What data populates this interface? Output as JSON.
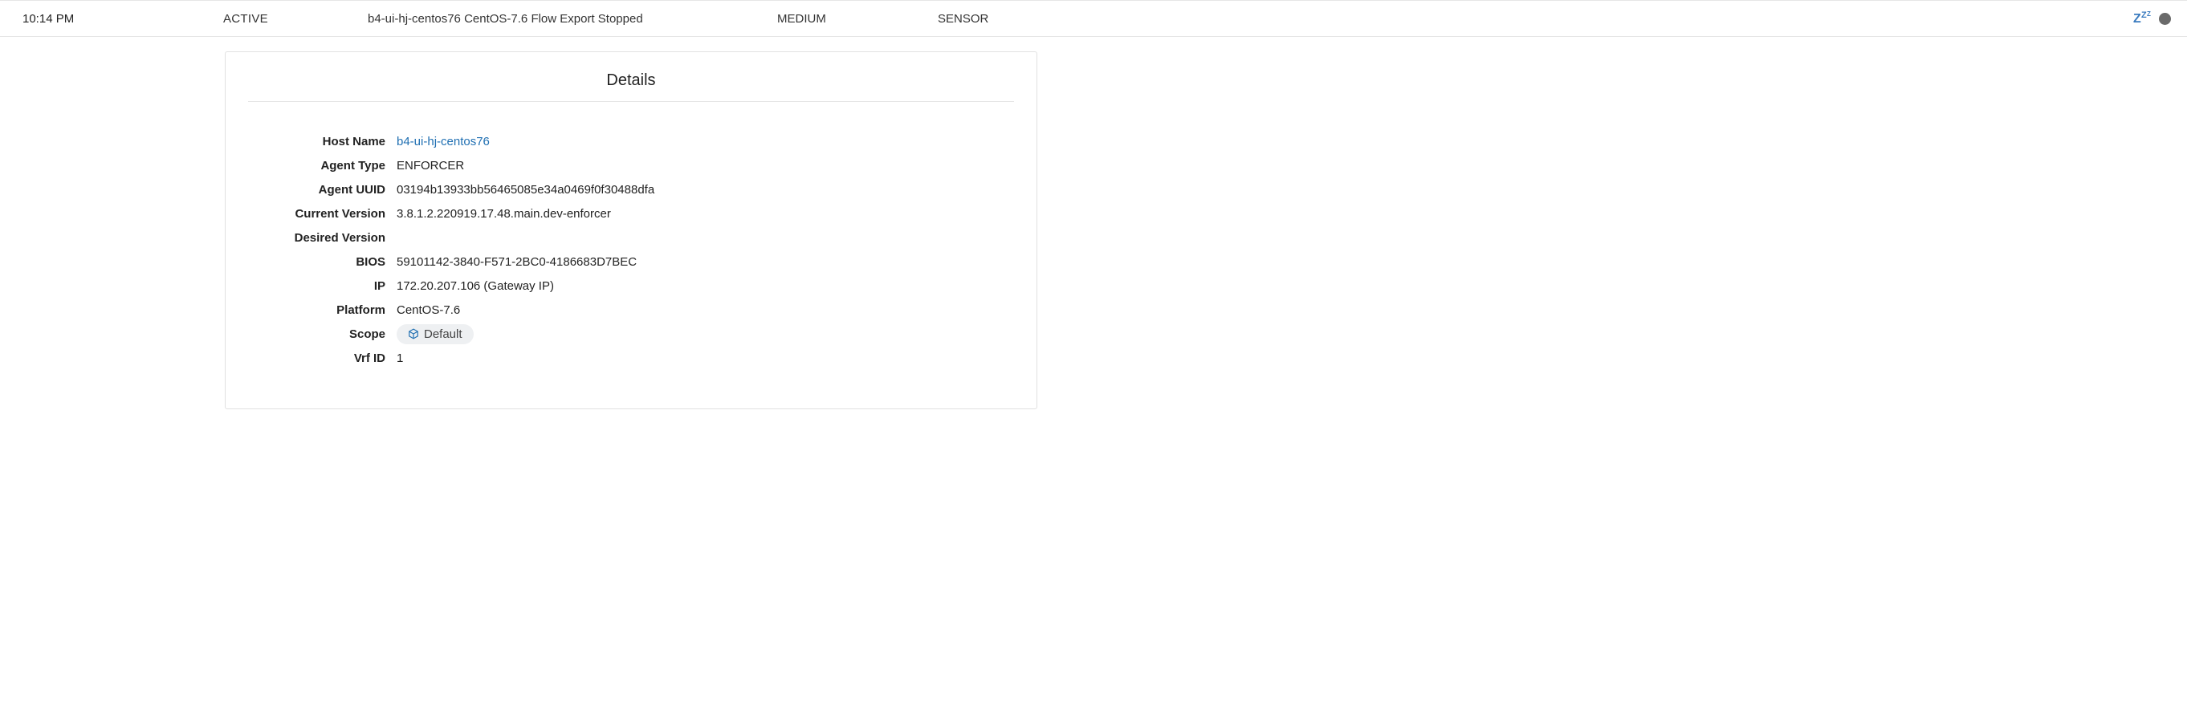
{
  "row": {
    "time": "10:14 PM",
    "status": "ACTIVE",
    "description": "b4-ui-hj-centos76 CentOS-7.6 Flow Export Stopped",
    "severity": "MEDIUM",
    "type": "SENSOR"
  },
  "details": {
    "title": "Details",
    "fields": {
      "host_name": {
        "label": "Host Name",
        "value": "b4-ui-hj-centos76"
      },
      "agent_type": {
        "label": "Agent Type",
        "value": "ENFORCER"
      },
      "agent_uuid": {
        "label": "Agent UUID",
        "value": "03194b13933bb56465085e34a0469f0f30488dfa"
      },
      "current_version": {
        "label": "Current Version",
        "value": "3.8.1.2.220919.17.48.main.dev-enforcer"
      },
      "desired_version": {
        "label": "Desired Version",
        "value": ""
      },
      "bios": {
        "label": "BIOS",
        "value": "59101142-3840-F571-2BC0-4186683D7BEC"
      },
      "ip": {
        "label": "IP",
        "value": "172.20.207.106 (Gateway IP)"
      },
      "platform": {
        "label": "Platform",
        "value": "CentOS-7.6"
      },
      "scope": {
        "label": "Scope",
        "value": "Default"
      },
      "vrf_id": {
        "label": "Vrf ID",
        "value": "1"
      }
    }
  }
}
